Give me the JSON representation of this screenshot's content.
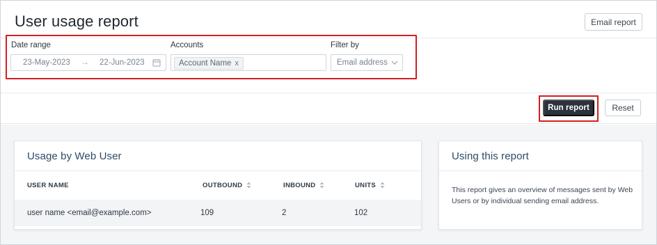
{
  "header": {
    "title": "User usage report",
    "email_report_label": "Email report"
  },
  "filters": {
    "date_range": {
      "label": "Date range",
      "start": "23-May-2023",
      "arrow": "→",
      "end": "22-Jun-2023"
    },
    "accounts": {
      "label": "Accounts",
      "tags": [
        {
          "text": "Account Name",
          "remove": "x"
        }
      ]
    },
    "filter_by": {
      "label": "Filter by",
      "selected": "Email address"
    }
  },
  "actions": {
    "run_label": "Run report",
    "reset_label": "Reset"
  },
  "usage_card": {
    "title": "Usage by Web User",
    "columns": [
      "USER NAME",
      "OUTBOUND",
      "INBOUND",
      "UNITS"
    ],
    "rows": [
      {
        "user": "user name <email@example.com>",
        "outbound": "109",
        "inbound": "2",
        "units": "102"
      }
    ]
  },
  "help_card": {
    "title": "Using this report",
    "text": "This report gives an overview of messages sent by Web Users or by individual sending email address."
  },
  "colors": {
    "highlight": "#d11f1f",
    "primary_button": "#2a323b",
    "card_title": "#2e4a66",
    "content_bg": "#f4f5f7"
  },
  "icons": [
    "calendar-icon",
    "chevron-down-icon",
    "sort-icon",
    "remove-tag-icon"
  ]
}
